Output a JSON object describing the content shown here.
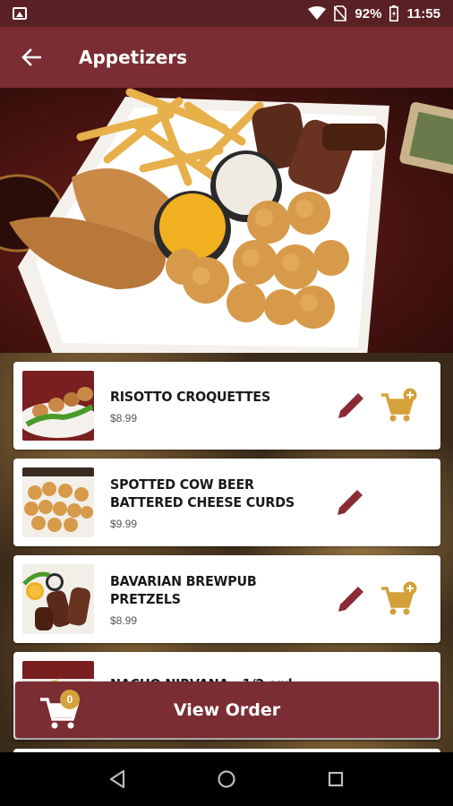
{
  "status_bar": {
    "battery": "92%",
    "time": "11:55"
  },
  "app_bar": {
    "title": "Appetizers"
  },
  "menu_items": [
    {
      "name": "RISOTTO CROQUETTES",
      "price": "$8.99"
    },
    {
      "name": "SPOTTED COW BEER BATTERED CHEESE CURDS",
      "price": "$9.99"
    },
    {
      "name": "BAVARIAN BREWPUB PRETZELS",
      "price": "$8.99"
    },
    {
      "name": "NACHO NIRVANA - 1/2 ord",
      "price": ""
    }
  ],
  "view_order": {
    "label": "View Order",
    "count": "0"
  },
  "colors": {
    "primary": "#7a2d33",
    "status_bar": "#5a2124",
    "accent": "#d4a23a",
    "edit_icon": "#8a2a35"
  },
  "icons": [
    "image-icon",
    "wifi-icon",
    "no-sim-icon",
    "battery-icon",
    "back-arrow-icon",
    "edit-pencil-icon",
    "add-to-cart-icon",
    "cart-icon",
    "nav-back-icon",
    "nav-home-icon",
    "nav-recents-icon"
  ]
}
